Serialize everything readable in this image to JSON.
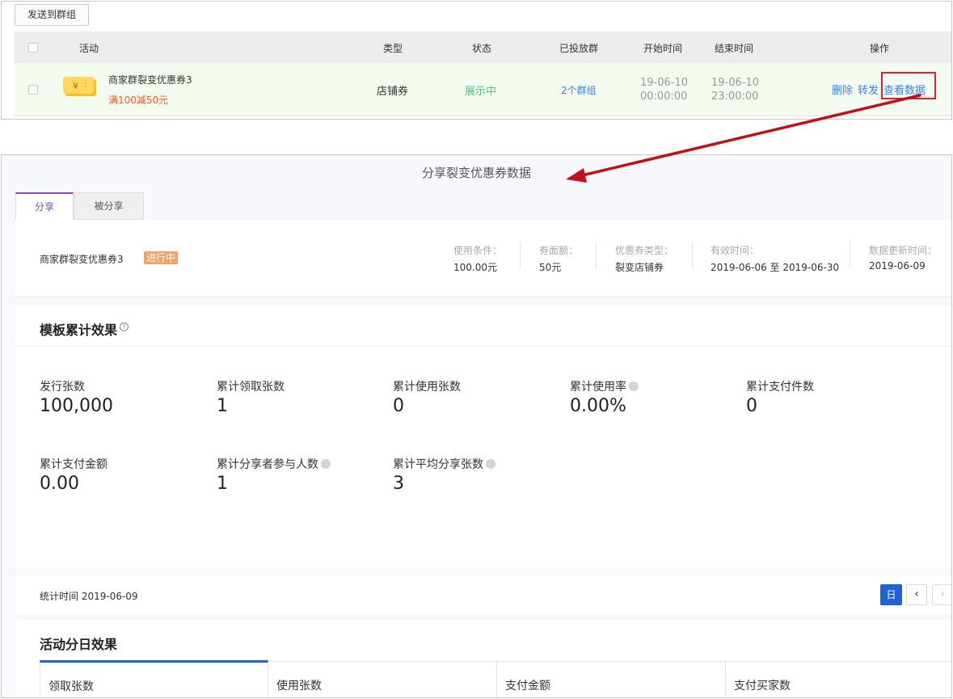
{
  "list": {
    "send_button": "发送到群组",
    "headers": {
      "activity": "活动",
      "type": "类型",
      "status": "状态",
      "groups": "已投放群",
      "start": "开始时间",
      "end": "结束时间",
      "ops": "操作"
    },
    "row": {
      "coupon_symbol": "¥",
      "name": "商家群裂变优惠券3",
      "price": "满100减50元",
      "type": "店铺券",
      "status": "展示中",
      "groups": "2个群组",
      "start_date": "19-06-10",
      "start_time": "00:00:00",
      "end_date": "19-06-10",
      "end_time": "23:00:00",
      "op_delete": "删除",
      "op_forward": "转发",
      "op_view": "查看数据"
    }
  },
  "panel": {
    "title": "分享裂变优惠券数据",
    "tabs": [
      "分享",
      "被分享"
    ],
    "coupon": {
      "name": "商家群裂变优惠券3",
      "badge": "进行中",
      "info": [
        {
          "label": "使用条件：",
          "value": "100.00元"
        },
        {
          "label": "券面额：",
          "value": "50元"
        },
        {
          "label": "优惠券类型：",
          "value": "裂变店铺券"
        },
        {
          "label": "有效时间：",
          "value": "2019-06-06 至 2019-06-30"
        },
        {
          "label": "数据更新时间：",
          "value": "2019-06-09"
        }
      ]
    },
    "metrics": {
      "title": "模板累计效果",
      "help_icon": "?",
      "items": [
        {
          "label": "发行张数",
          "value": "100,000"
        },
        {
          "label": "累计领取张数",
          "value": "1"
        },
        {
          "label": "累计使用张数",
          "value": "0"
        },
        {
          "label": "累计使用率",
          "value": "0.00%"
        },
        {
          "label": "累计支付件数",
          "value": "0"
        },
        {
          "label": "累计支付金额",
          "value": "0.00"
        },
        {
          "label": "累计分享者参与人数",
          "value": "1"
        },
        {
          "label": "累计平均分享张数",
          "value": "3"
        }
      ]
    },
    "stat": {
      "time": "统计时间 2019-06-09",
      "day_button": "日",
      "prev": "‹",
      "next": "›"
    },
    "daily": {
      "title": "活动分日效果",
      "tabs": [
        "领取张数",
        "使用张数",
        "支付金额",
        "支付买家数"
      ]
    }
  },
  "colors": {
    "accent_blue": "#1e63d6",
    "link_blue": "#3b82f6",
    "status_green": "#55c47a",
    "price_orange": "#ff5a1f",
    "badge_orange": "#f4a26a",
    "tab_purple": "#8b46c6",
    "annotation_red": "#c0101a"
  }
}
